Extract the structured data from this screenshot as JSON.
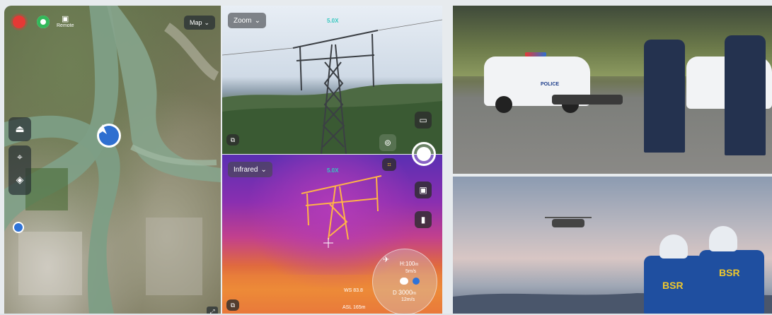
{
  "map": {
    "remote_label": "Remote",
    "map_select": "Map",
    "icons": [
      "record-icon",
      "gps-icon",
      "remote-controller-icon",
      "drone-marker-icon",
      "target-icon",
      "layers-icon",
      "expand-icon"
    ]
  },
  "zoom_view": {
    "mode": "Zoom",
    "zoom_value": "5.0X"
  },
  "infrared_view": {
    "mode": "Infrared",
    "zoom_value": "5.0X"
  },
  "telemetry": {
    "h_label": "H:",
    "h_value": "100",
    "h_unit": "m",
    "speed_value": "5",
    "speed_unit": "m/s",
    "d_label": "D",
    "d_value": "3000",
    "d_unit": "m",
    "d_speed": "12",
    "d_speed_unit": "m/s",
    "ws_label": "WS",
    "ws_value": "83.8",
    "asl_label": "ASL",
    "asl_value": "165",
    "asl_unit": "m"
  },
  "photos": {
    "police_car_text": "POLICE",
    "vest_text_left": "BSR",
    "vest_text_right": "BSR"
  },
  "colors": {
    "accent_blue": "#2f6fd0",
    "record_red": "#e53935",
    "status_green": "#33b85a",
    "zoom_text_teal": "#36c8c0",
    "vest_yellow": "#f0c82c"
  }
}
